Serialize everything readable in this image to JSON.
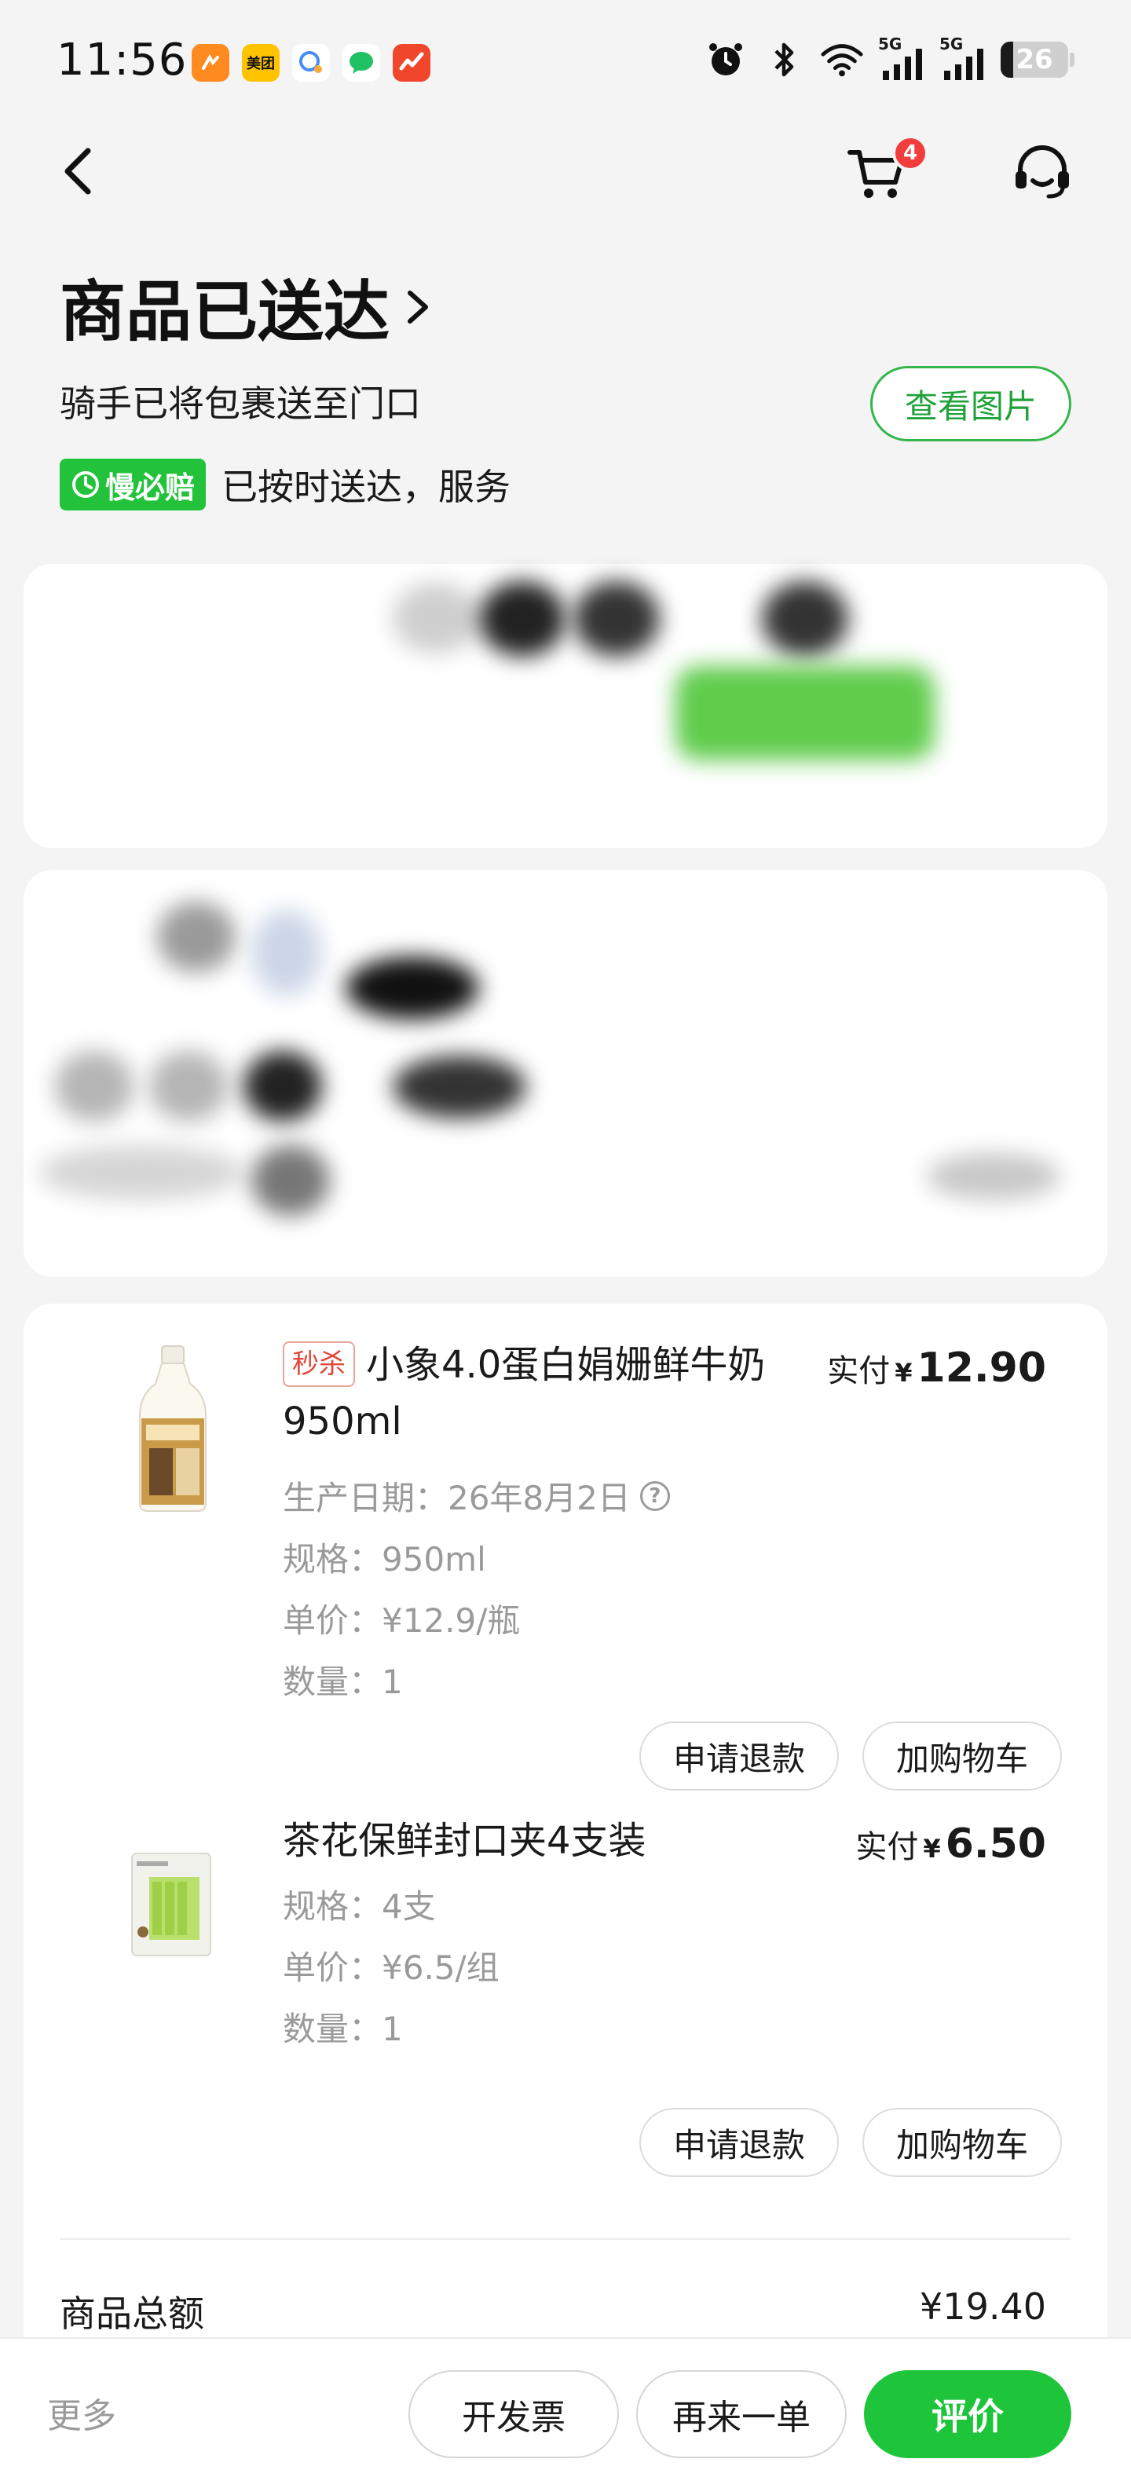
{
  "status_bar": {
    "time": "11:56",
    "app_icons": [
      "meituan-waimai-icon",
      "meituan-icon",
      "chat-icon",
      "message-icon",
      "stock-icon"
    ],
    "meituan_label": "美团",
    "signal_1": "5G",
    "signal_2": "5G",
    "battery": "26"
  },
  "header": {
    "cart_count": "4"
  },
  "delivery": {
    "title": "商品已送达",
    "subtitle": "骑手已将包裹送至门口",
    "view_photo": "查看图片",
    "guarantee_badge": "慢必赔",
    "guarantee_text": "已按时送达，服务"
  },
  "products": [
    {
      "tag": "秒杀",
      "name": "小象4.0蛋白娟姗鲜牛奶950ml",
      "price_label": "实付",
      "currency": "¥",
      "price": "12.90",
      "production_date": "生产日期：26年8月2日",
      "spec": "规格：950ml",
      "unit_price": "单价：¥12.9/瓶",
      "quantity": "数量：1",
      "refund": "申请退款",
      "add_cart": "加购物车"
    },
    {
      "name": "茶花保鲜封口夹4支装",
      "price_label": "实付",
      "currency": "¥",
      "price": "6.50",
      "spec": "规格：4支",
      "unit_price": "单价：¥6.5/组",
      "quantity": "数量：1",
      "refund": "申请退款",
      "add_cart": "加购物车"
    }
  ],
  "summary": {
    "label": "商品总额",
    "value": "¥19.40"
  },
  "bottom_bar": {
    "more": "更多",
    "invoice": "开发票",
    "reorder": "再来一单",
    "review": "评价"
  },
  "colors": {
    "brand_green": "#1ec43a",
    "badge_red": "#f33d3d",
    "flash_red": "#e0473a"
  }
}
